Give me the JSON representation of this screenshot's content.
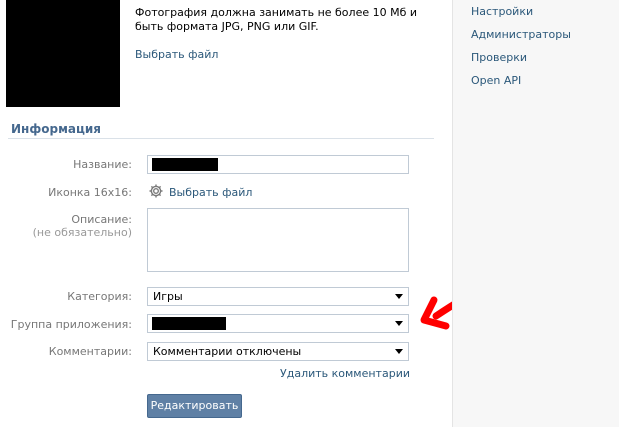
{
  "photo": {
    "note": "Фотография должна занимать не более 10 Мб и быть формата JPG, PNG или GIF.",
    "choose_file": "Выбрать файл"
  },
  "section": {
    "title": "Информация"
  },
  "form": {
    "name_label": "Название:",
    "icon_label": "Иконка 16x16:",
    "icon_choose_file": "Выбрать файл",
    "description_label": "Описание:",
    "description_hint": "(не обязательно)",
    "category_label": "Категория:",
    "category_value": "Игры",
    "app_group_label": "Группа приложения:",
    "comments_label": "Комментарии:",
    "comments_value": "Комментарии отключены",
    "delete_comments": "Удалить комментарии",
    "submit": "Редактировать"
  },
  "sidebar": {
    "items": [
      {
        "label": "Настройки"
      },
      {
        "label": "Администраторы"
      },
      {
        "label": "Проверки"
      },
      {
        "label": "Open API"
      }
    ]
  },
  "colors": {
    "link": "#2b587a",
    "section_title": "#45688e",
    "button_bg": "#5f80a5",
    "annotation_arrow": "#ff0000"
  }
}
